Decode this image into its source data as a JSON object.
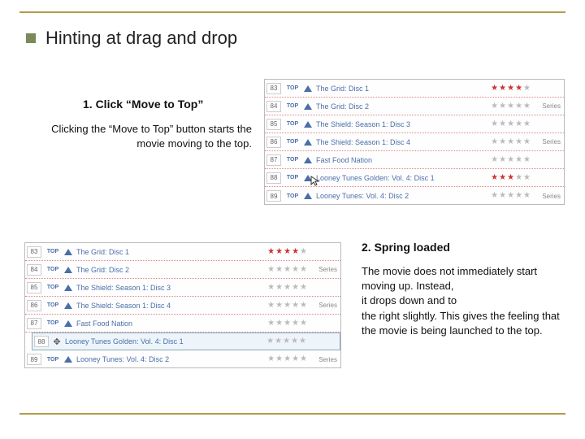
{
  "title": "Hinting at drag and drop",
  "step1": {
    "title": "1. Click “Move to Top”",
    "body": "Clicking the “Move to Top” button starts the  movie moving to the top."
  },
  "step2": {
    "title": "2. Spring loaded",
    "body": "The movie does not immediately start moving up. Instead,\nit drops down and to\nthe right slightly. This gives the feeling that the movie is being launched to the top."
  },
  "labels": {
    "top": "TOP",
    "series": "Series"
  },
  "queue1": [
    {
      "num": "83",
      "title": "The Grid: Disc 1",
      "rating": 4,
      "series": false
    },
    {
      "num": "84",
      "title": "The Grid: Disc 2",
      "rating": 0,
      "series": true
    },
    {
      "num": "85",
      "title": "The Shield: Season 1: Disc 3",
      "rating": 0,
      "series": false
    },
    {
      "num": "86",
      "title": "The Shield: Season 1: Disc 4",
      "rating": 0,
      "series": true
    },
    {
      "num": "87",
      "title": "Fast Food Nation",
      "rating": 0,
      "series": false
    },
    {
      "num": "88",
      "title": "Looney Tunes Golden: Vol. 4: Disc 1",
      "rating": 3,
      "series": false,
      "cursor": true
    },
    {
      "num": "89",
      "title": "Looney Tunes: Vol. 4: Disc 2",
      "rating": 0,
      "series": true
    }
  ],
  "queue2": [
    {
      "num": "83",
      "title": "The Grid: Disc 1",
      "rating": 4,
      "series": false
    },
    {
      "num": "84",
      "title": "The Grid: Disc 2",
      "rating": 0,
      "series": true
    },
    {
      "num": "85",
      "title": "The Shield: Season 1: Disc 3",
      "rating": 0,
      "series": false
    },
    {
      "num": "86",
      "title": "The Shield: Season 1: Disc 4",
      "rating": 0,
      "series": true
    },
    {
      "num": "87",
      "title": "Fast Food Nation",
      "rating": 0,
      "series": false
    },
    {
      "num": "88",
      "title": "Looney Tunes Golden: Vol. 4: Disc 1",
      "rating": 0,
      "series": false,
      "highlight": true
    },
    {
      "num": "89",
      "title": "Looney Tunes: Vol. 4: Disc 2",
      "rating": 0,
      "series": true
    }
  ]
}
